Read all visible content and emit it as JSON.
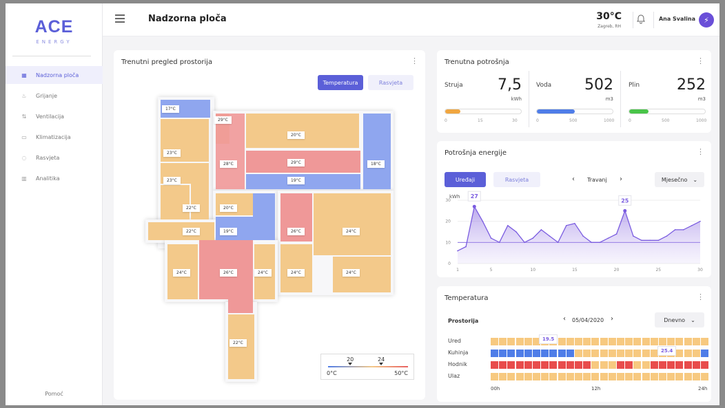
{
  "sidebar": {
    "logo_main": "ACE",
    "logo_sub": "ENERGY",
    "items": [
      {
        "label": "Nadzorna ploča",
        "icon": "dashboard-icon",
        "active": true
      },
      {
        "label": "Grijanje",
        "icon": "heating-icon",
        "active": false
      },
      {
        "label": "Ventilacija",
        "icon": "ventilation-icon",
        "active": false
      },
      {
        "label": "Klimatizacija",
        "icon": "ac-icon",
        "active": false
      },
      {
        "label": "Rasvjeta",
        "icon": "bulb-icon",
        "active": false
      },
      {
        "label": "Analitika",
        "icon": "analytics-icon",
        "active": false
      }
    ],
    "help": "Pomoć"
  },
  "header": {
    "title": "Nadzorna ploča",
    "temperature": "30°C",
    "location": "Zagreb, RH",
    "user": "Ana Svalina"
  },
  "floorplan": {
    "title": "Trenutni pregled prostorija",
    "buttons": [
      "Temperatura",
      "Rasvjeta"
    ],
    "rooms": [
      "17°C",
      "29°C",
      "20°C",
      "23°C",
      "28°C",
      "29°C",
      "18°C",
      "23°C",
      "19°C",
      "22°C",
      "20°C",
      "22°C",
      "19°C",
      "26°C",
      "24°C",
      "24°C",
      "26°C",
      "24°C",
      "24°C",
      "24°C",
      "22°C"
    ],
    "legend": {
      "min": "0°C",
      "max": "50°C",
      "mark1": "20",
      "mark2": "24"
    }
  },
  "consumption": {
    "title": "Trenutna potrošnja",
    "items": [
      {
        "label": "Struja",
        "value": "7,5",
        "unit": "kWh",
        "fill": 0.2,
        "ticks": [
          "0",
          "15",
          "30"
        ],
        "color": "#f0a640"
      },
      {
        "label": "Voda",
        "value": "502",
        "unit": "m3",
        "fill": 0.5,
        "ticks": [
          "0",
          "500",
          "1000"
        ],
        "color": "#4f7de8"
      },
      {
        "label": "Plin",
        "value": "252",
        "unit": "m3",
        "fill": 0.25,
        "ticks": [
          "0",
          "500",
          "1000"
        ],
        "color": "#49c449"
      }
    ]
  },
  "energy": {
    "title": "Potrošnja energije",
    "buttons": [
      "Uređaji",
      "Rasvjeta"
    ],
    "month": "Travanj",
    "period": "Mjesečno",
    "ylabel": "kWh",
    "peak1": "27",
    "peak2": "25"
  },
  "chart_data": {
    "type": "area",
    "x": [
      1,
      2,
      3,
      4,
      5,
      6,
      7,
      8,
      9,
      10,
      11,
      12,
      13,
      14,
      15,
      16,
      17,
      18,
      19,
      20,
      21,
      22,
      23,
      24,
      25,
      26,
      27,
      28,
      29,
      30
    ],
    "values": [
      6,
      8,
      27,
      20,
      12,
      10,
      18,
      15,
      10,
      12,
      16,
      13,
      10,
      18,
      19,
      13,
      10,
      10,
      12,
      14,
      25,
      13,
      11,
      11,
      11,
      13,
      16,
      16,
      18,
      20
    ],
    "ylabel": "kWh",
    "yticks": [
      "0",
      "10",
      "20",
      "30"
    ],
    "xticks": [
      "1",
      "5",
      "10",
      "15",
      "20",
      "25",
      "30"
    ],
    "ylim": [
      0,
      30
    ]
  },
  "temperature": {
    "title": "Temperatura",
    "column": "Prostorija",
    "date": "05/04/2020",
    "period": "Dnevno",
    "rows": [
      "Ured",
      "Kuhinja",
      "Hodnik",
      "Ulaz"
    ],
    "time_labels": [
      "00h",
      "12h",
      "24h"
    ],
    "callout1": "19.5",
    "callout2": "25.4"
  }
}
